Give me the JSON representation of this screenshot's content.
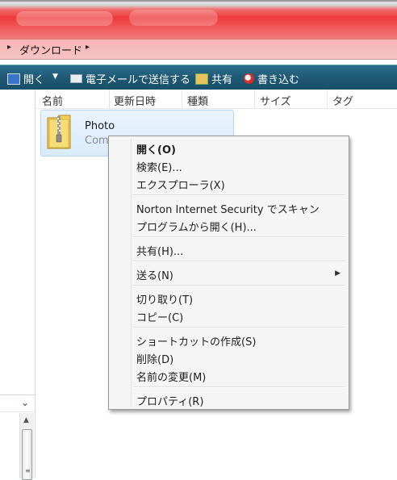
{
  "address": {
    "path": "ダウンロード"
  },
  "toolbar": {
    "open": "開く",
    "email": "電子メールで送信する",
    "share": "共有",
    "burn": "書き込む"
  },
  "columns": [
    "名前",
    "更新日時",
    "種類",
    "サイズ",
    "タグ"
  ],
  "file": {
    "name": "Photo",
    "type_truncated": "Com"
  },
  "context_menu": {
    "open": "開く(O)",
    "search": "検索(E)...",
    "explorer": "エクスプローラ(X)",
    "norton": "Norton Internet Security でスキャン",
    "open_with": "プログラムから開く(H)...",
    "share": "共有(H)...",
    "send_to": "送る(N)",
    "cut": "切り取り(T)",
    "copy": "コピー(C)",
    "create_shortcut": "ショートカットの作成(S)",
    "delete": "削除(D)",
    "rename": "名前の変更(M)",
    "properties": "プロパティ(R)"
  },
  "icons": {
    "open": "open-folder-icon",
    "email": "envelope-icon",
    "share": "share-people-icon",
    "burn": "disc-burn-icon",
    "file": "zip-folder-icon"
  }
}
